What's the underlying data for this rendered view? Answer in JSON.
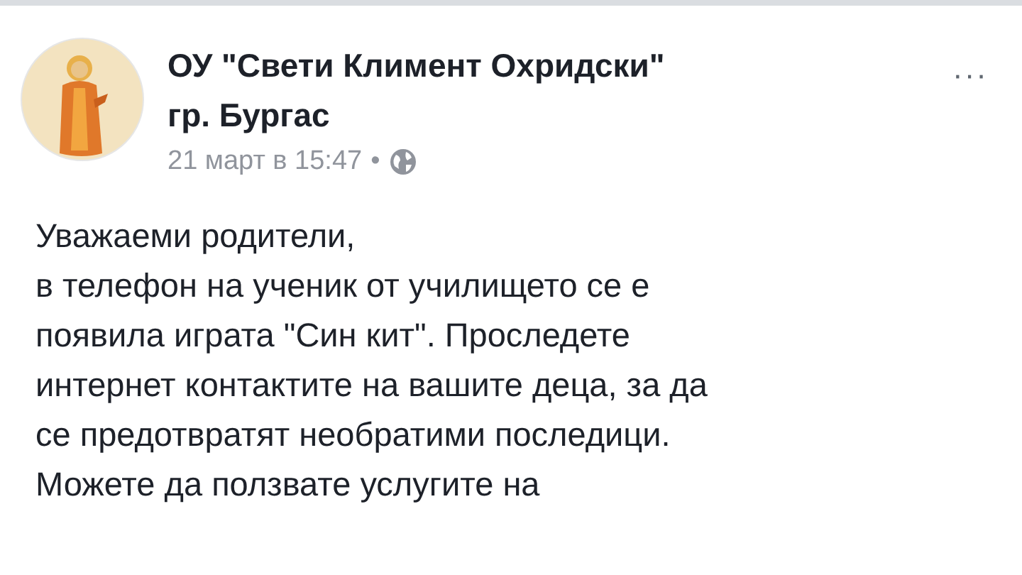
{
  "post": {
    "author_lines": [
      "ОУ \"Свети Климент Охридски\"",
      "гр. Бургас"
    ],
    "timestamp": "21 март в 15:47",
    "separator": "•",
    "more": "···",
    "body_lines": [
      "Уважаеми родители,",
      "в телефон на ученик от училището се е",
      "появила играта \"Син кит\". Проследете",
      "интернет контактите на вашите деца, за да",
      "се предотвратят необратими последици.",
      "Можете да ползвате услугите на"
    ]
  }
}
